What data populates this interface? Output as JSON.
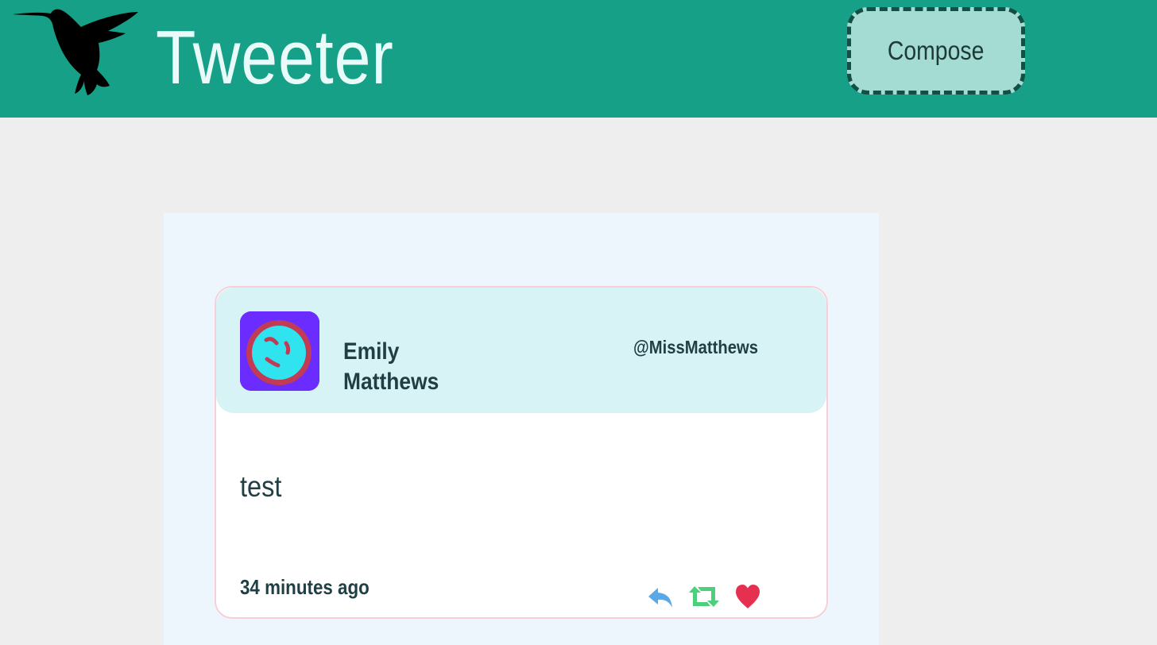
{
  "header": {
    "brand": "Tweeter",
    "logo_icon": "hummingbird-icon",
    "compose_label": "Compose"
  },
  "colors": {
    "nav_bg": "#17a088",
    "brand_text": "#e8fbf8",
    "compose_bg": "#a4dbd3",
    "compose_border": "#124f45",
    "page_bg": "#eeeeee",
    "feed_bg": "#eef6fd",
    "tweet_header_bg": "#d8f3f6",
    "tweet_border": "#f7cfd9",
    "text": "#1f3f45",
    "reply": "#5aa9e6",
    "retweet": "#4cd07d",
    "like": "#e5304f"
  },
  "tweet": {
    "display_name": "Emily Matthews",
    "handle": "@MissMatthews",
    "avatar_icon": "avatar-image",
    "content": "test",
    "timestamp": "34 minutes ago",
    "actions": [
      {
        "name": "reply",
        "icon": "reply-icon"
      },
      {
        "name": "retweet",
        "icon": "retweet-icon"
      },
      {
        "name": "like",
        "icon": "heart-icon"
      }
    ]
  }
}
